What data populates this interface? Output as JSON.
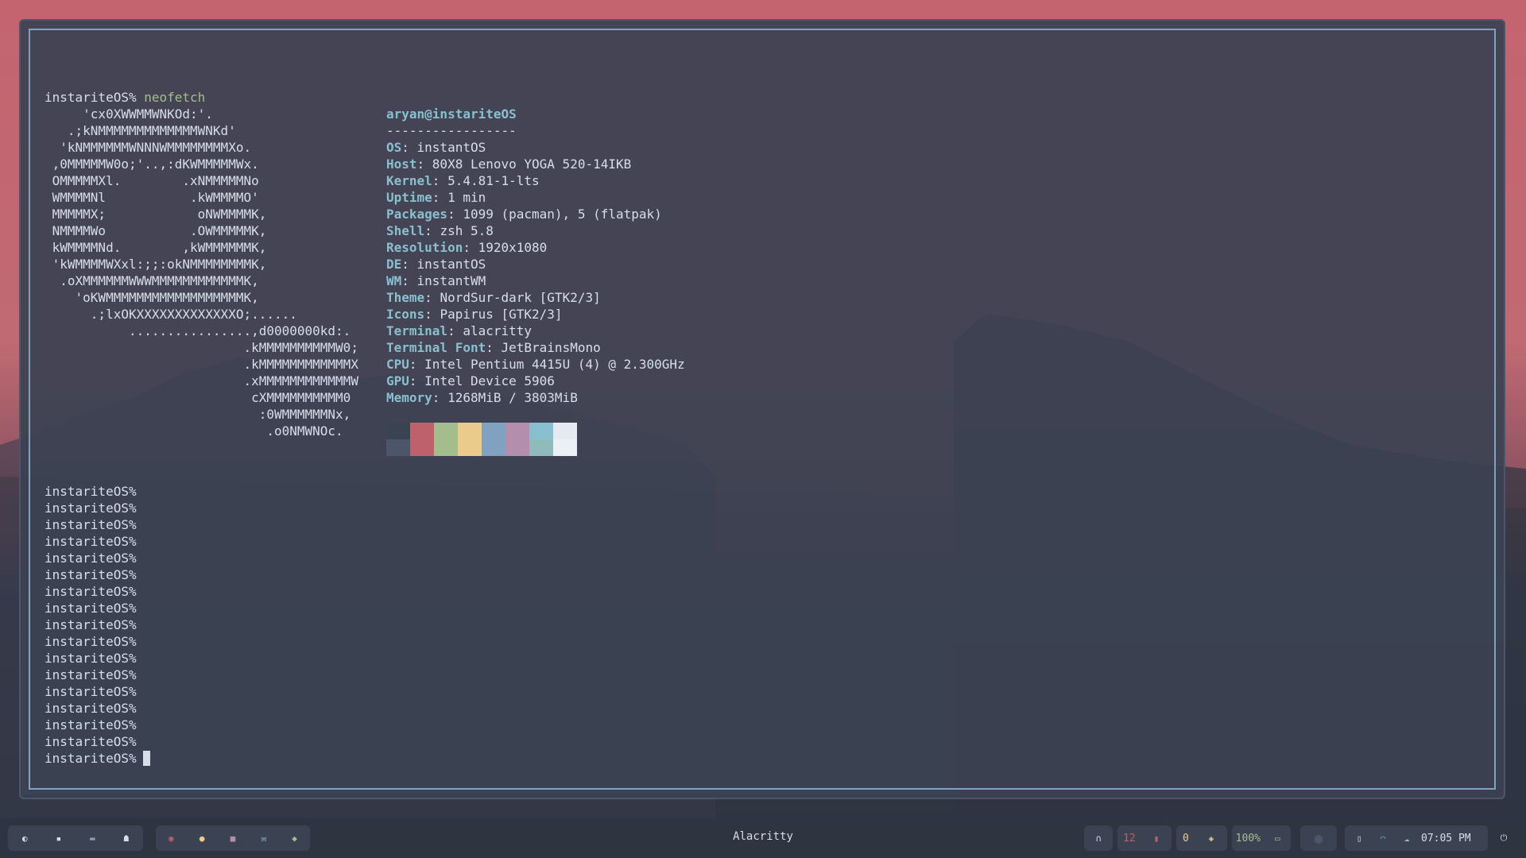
{
  "terminal": {
    "first_prompt": "instariteOS%",
    "first_command": "neofetch",
    "logo_lines": [
      "     'cx0XWWMMWNKOd:'.",
      "   .;kNMMMMMMMMMMMMMWNKd'",
      "  'kNMMMMMMWNNNWMMMMMMMMXo.",
      " ,0MMMMMW0o;'..,:dKWMMMMMWx.",
      " OMMMMMXl.        .xNMMMMMNo",
      " WMMMMNl           .kWMMMMO'",
      " MMMMMX;            oNWMMMMK,",
      " NMMMMWo           .OWMMMMMK,",
      " kWMMMMNd.        ,kWMMMMMMK,",
      " 'kWMMMMWXxl:;;:okNMMMMMMMMK,",
      "  .oXMMMMMMWWWMMMMMMMMMMMMK,",
      "    'oKWMMMMMMMMMMMMMMMMMMK,",
      "      .;lxOKXXXXXXXXXXXXXO;......",
      "           ................,d0000000kd:.",
      "                          .kMMMMMMMMMMW0;",
      "                          .kMMMMMMMMMMMMX",
      "                          .xMMMMMMMMMMMMW",
      "                           cXMMMMMMMMMM0",
      "                            :0WMMMMMMNx,",
      "                             .o0NMWNOc."
    ],
    "userhost": "aryan@instariteOS",
    "separator": "-----------------",
    "info": [
      {
        "key": "OS",
        "value": ": instantOS"
      },
      {
        "key": "Host",
        "value": ": 80X8 Lenovo YOGA 520-14IKB"
      },
      {
        "key": "Kernel",
        "value": ": 5.4.81-1-lts"
      },
      {
        "key": "Uptime",
        "value": ": 1 min"
      },
      {
        "key": "Packages",
        "value": ": 1099 (pacman), 5 (flatpak)"
      },
      {
        "key": "Shell",
        "value": ": zsh 5.8"
      },
      {
        "key": "Resolution",
        "value": ": 1920x1080"
      },
      {
        "key": "DE",
        "value": ": instantOS"
      },
      {
        "key": "WM",
        "value": ": instantWM"
      },
      {
        "key": "Theme",
        "value": ": NordSur-dark [GTK2/3]"
      },
      {
        "key": "Icons",
        "value": ": Papirus [GTK2/3]"
      },
      {
        "key": "Terminal",
        "value": ": alacritty"
      },
      {
        "key": "Terminal Font",
        "value": ": JetBrainsMono"
      },
      {
        "key": "CPU",
        "value": ": Intel Pentium 4415U (4) @ 2.300GHz"
      },
      {
        "key": "GPU",
        "value": ": Intel Device 5906"
      },
      {
        "key": "Memory",
        "value": ": 1268MiB / 3803MiB"
      }
    ],
    "palette": [
      {
        "top": "#3b4252",
        "bottom": "#4c566a"
      },
      {
        "top": "#bf616a",
        "bottom": "#bf616a"
      },
      {
        "top": "#a3be8c",
        "bottom": "#a3be8c"
      },
      {
        "top": "#ebcb8b",
        "bottom": "#ebcb8b"
      },
      {
        "top": "#81a1c1",
        "bottom": "#81a1c1"
      },
      {
        "top": "#b48ead",
        "bottom": "#b48ead"
      },
      {
        "top": "#88c0d0",
        "bottom": "#8fbcbb"
      },
      {
        "top": "#e5e9f0",
        "bottom": "#eceff4"
      }
    ],
    "prompt": "instariteOS%",
    "prompt_count": 17
  },
  "taskbar": {
    "window_title": "Alacritty",
    "left_icons": [
      "moon-icon",
      "terminal-icon",
      "folder-icon",
      "ghost-icon"
    ],
    "app_icons": [
      "github-icon",
      "reddit-icon",
      "pink-app-icon",
      "mail-icon",
      "cat-icon"
    ],
    "notifications_count": "12",
    "updates_count": "0",
    "battery": "100%",
    "clock": "07:05 PM",
    "colors": {
      "accent": "#88c0d0",
      "red": "#bf616a",
      "yellow": "#ebcb8b",
      "green": "#a3be8c"
    }
  }
}
